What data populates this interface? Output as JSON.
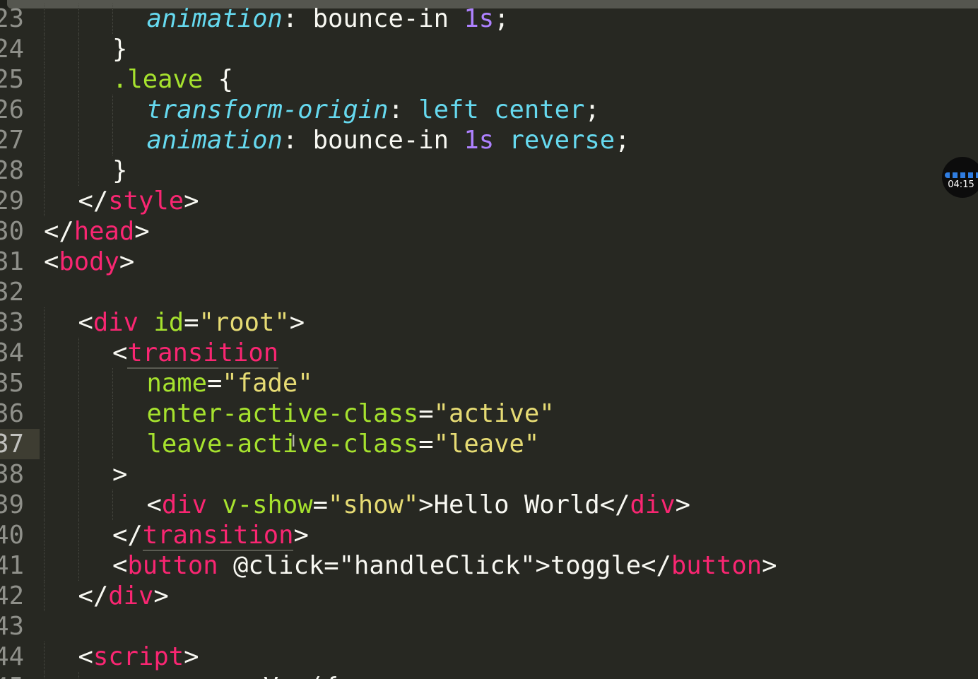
{
  "editor": {
    "language": "html",
    "theme_colors": {
      "background": "#272822",
      "tag": "#f92672",
      "attribute": "#a6e22e",
      "string": "#e6db74",
      "property": "#66d9ef",
      "number": "#ae81ff",
      "plain": "#f8f8f2",
      "line_number": "#8f908a"
    },
    "active_line_number": "37",
    "lines": [
      {
        "num": "23",
        "tokens": [
          [
            "t-prop",
            "animation"
          ],
          [
            "t-plain",
            ": bounce-in "
          ],
          [
            "t-num",
            "1s"
          ],
          [
            "t-plain",
            ";"
          ]
        ],
        "indent": 3
      },
      {
        "num": "24",
        "tokens": [
          [
            "t-plain",
            "}"
          ]
        ],
        "indent": 2
      },
      {
        "num": "25",
        "tokens": [
          [
            "t-sel",
            ".leave"
          ],
          [
            "t-plain",
            " {"
          ]
        ],
        "indent": 2
      },
      {
        "num": "26",
        "tokens": [
          [
            "t-prop",
            "transform-origin"
          ],
          [
            "t-plain",
            ": "
          ],
          [
            "t-kw",
            "left center"
          ],
          [
            "t-plain",
            ";"
          ]
        ],
        "indent": 3
      },
      {
        "num": "27",
        "tokens": [
          [
            "t-prop",
            "animation"
          ],
          [
            "t-plain",
            ": bounce-in "
          ],
          [
            "t-num",
            "1s"
          ],
          [
            "t-plain",
            " "
          ],
          [
            "t-kw",
            "reverse"
          ],
          [
            "t-plain",
            ";"
          ]
        ],
        "indent": 3
      },
      {
        "num": "28",
        "tokens": [
          [
            "t-plain",
            "}"
          ]
        ],
        "indent": 2
      },
      {
        "num": "29",
        "tokens": [
          [
            "t-plain",
            "</"
          ],
          [
            "t-tag",
            "style"
          ],
          [
            "t-plain",
            ">"
          ]
        ],
        "indent": 1
      },
      {
        "num": "30",
        "tokens": [
          [
            "t-plain",
            "</"
          ],
          [
            "t-tag",
            "head"
          ],
          [
            "t-plain",
            ">"
          ]
        ],
        "indent": 0
      },
      {
        "num": "31",
        "tokens": [
          [
            "t-plain",
            "<"
          ],
          [
            "t-tag",
            "body"
          ],
          [
            "t-plain",
            ">"
          ]
        ],
        "indent": 0
      },
      {
        "num": "32",
        "tokens": [],
        "indent": 0
      },
      {
        "num": "33",
        "tokens": [
          [
            "t-plain",
            "<"
          ],
          [
            "t-tag",
            "div"
          ],
          [
            "t-plain",
            " "
          ],
          [
            "t-attr",
            "id"
          ],
          [
            "t-plain",
            "="
          ],
          [
            "t-str",
            "\"root\""
          ],
          [
            "t-plain",
            ">"
          ]
        ],
        "indent": 1
      },
      {
        "num": "34",
        "tokens": [
          [
            "t-plain",
            "<"
          ],
          [
            "t-tag t-underline",
            "transition"
          ]
        ],
        "indent": 2
      },
      {
        "num": "35",
        "tokens": [
          [
            "t-attr",
            "name"
          ],
          [
            "t-plain",
            "="
          ],
          [
            "t-str",
            "\"fade\""
          ]
        ],
        "indent": 3
      },
      {
        "num": "36",
        "tokens": [
          [
            "t-attr",
            "enter-active-class"
          ],
          [
            "t-plain",
            "="
          ],
          [
            "t-str",
            "\"active\""
          ]
        ],
        "indent": 3
      },
      {
        "num": "37",
        "tokens": [
          [
            "t-attr",
            "leave-active-class"
          ],
          [
            "t-plain",
            "="
          ],
          [
            "t-str",
            "\"leave\""
          ]
        ],
        "indent": 3
      },
      {
        "num": "38",
        "tokens": [
          [
            "t-plain",
            ">"
          ]
        ],
        "indent": 2
      },
      {
        "num": "39",
        "tokens": [
          [
            "t-plain",
            "<"
          ],
          [
            "t-tag",
            "div"
          ],
          [
            "t-plain",
            " "
          ],
          [
            "t-attr",
            "v-show"
          ],
          [
            "t-plain",
            "="
          ],
          [
            "t-str",
            "\"show\""
          ],
          [
            "t-plain",
            ">Hello World</"
          ],
          [
            "t-tag",
            "div"
          ],
          [
            "t-plain",
            ">"
          ]
        ],
        "indent": 3
      },
      {
        "num": "40",
        "tokens": [
          [
            "t-plain",
            "</"
          ],
          [
            "t-tag t-underline",
            "transition"
          ],
          [
            "t-plain",
            ">"
          ]
        ],
        "indent": 2
      },
      {
        "num": "41",
        "tokens": [
          [
            "t-plain",
            "<"
          ],
          [
            "t-tag",
            "button"
          ],
          [
            "t-plain",
            " "
          ],
          [
            "t-plain",
            "@click"
          ],
          [
            "t-plain",
            "="
          ],
          [
            "t-plain",
            "\"handleClick\""
          ],
          [
            "t-plain",
            ">toggle</"
          ],
          [
            "t-tag",
            "button"
          ],
          [
            "t-plain",
            ">"
          ]
        ],
        "indent": 2
      },
      {
        "num": "42",
        "tokens": [
          [
            "t-plain",
            "</"
          ],
          [
            "t-tag",
            "div"
          ],
          [
            "t-plain",
            ">"
          ]
        ],
        "indent": 1
      },
      {
        "num": "43",
        "tokens": [],
        "indent": 0
      },
      {
        "num": "44",
        "tokens": [
          [
            "t-plain",
            "<"
          ],
          [
            "t-tag",
            "script"
          ],
          [
            "t-plain",
            ">"
          ]
        ],
        "indent": 1
      },
      {
        "num": "45",
        "tokens": [
          [
            "t-plain",
            "          Vue({"
          ]
        ],
        "indent": 2
      }
    ]
  },
  "video_badge": {
    "time": "04:15",
    "icon": "waveform-icon"
  }
}
